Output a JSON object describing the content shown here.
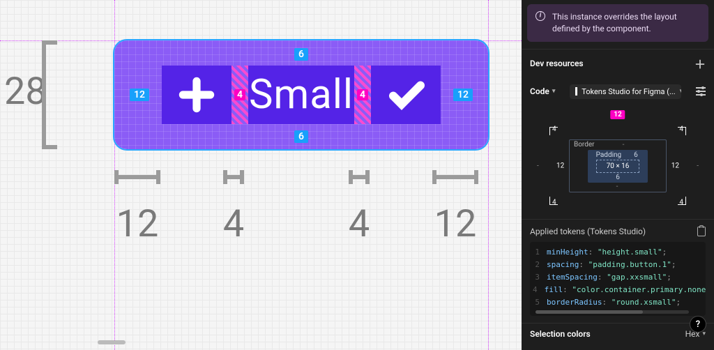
{
  "canvas": {
    "frame_text": "Small",
    "height_label": "28",
    "ann_top": "6",
    "ann_bottom": "6",
    "ann_left": "12",
    "ann_right": "12",
    "spacer": "4",
    "bottom_labels": [
      "12",
      "4",
      "4",
      "12"
    ]
  },
  "panel": {
    "notice": "This instance overrides the layout defined by the component.",
    "dev_resources_label": "Dev resources",
    "code_label": "Code",
    "code_source": "Tokens Studio for Figma (...",
    "boxmodel": {
      "above": "12",
      "corner": "4",
      "border_label": "Border",
      "border_dash": "-",
      "side_12": "12",
      "side_dash": "-",
      "padding_label": "Padding",
      "padding_v": "6",
      "inner_dims": "70 × 16"
    },
    "applied_tokens_label": "Applied tokens (Tokens Studio)",
    "tokens": [
      {
        "k": "minHeight",
        "v": "\"height.small\""
      },
      {
        "k": "spacing",
        "v": "\"padding.button.1\""
      },
      {
        "k": "itemSpacing",
        "v": "\"gap.xxsmall\""
      },
      {
        "k": "fill",
        "v": "\"color.container.primary.none.ena"
      },
      {
        "k": "borderRadius",
        "v": "\"round.xsmall\""
      }
    ],
    "selection_colors_label": "Selection colors",
    "hex_label": "Hex"
  }
}
